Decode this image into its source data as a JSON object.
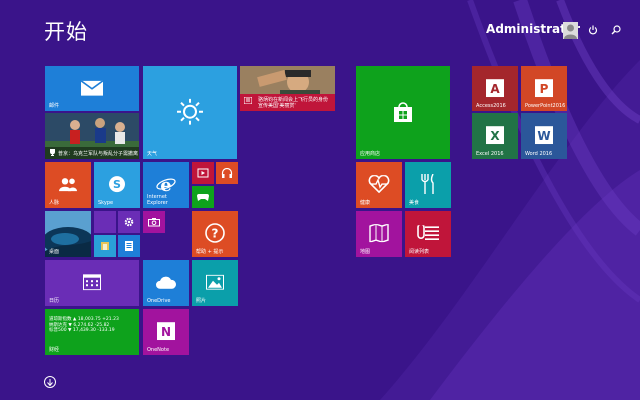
{
  "header": {
    "title": "开始",
    "user_name": "Administrator"
  },
  "icons": {
    "power": "power-icon",
    "search": "search-icon",
    "down": "arrow-down-icon"
  },
  "colors": {
    "background": "#3a148a",
    "blue": "#1e7fd8",
    "red": "#dd4c24",
    "green": "#0ea21c",
    "purple": "#6a2db6",
    "magenta": "#a2139e",
    "lightblue": "#2ca0e0",
    "teal": "#0b9faa",
    "access": "#a4262c",
    "powerpoint": "#d24726",
    "excel": "#217346",
    "word": "#2b579a"
  },
  "tiles": {
    "mail": "邮件",
    "news_caption": "普京：乌克兰军队与叛乱分子需撤离",
    "weather": "天气",
    "news_headline": "骆炳钧在新闻会上飞行员的身份宣传美国'美丽赏'",
    "store": "应用商店",
    "access": "Access2016",
    "powerpoint": "PowerPoint2016",
    "excel": "Excel 2016",
    "word": "Word 2016",
    "people": "人脉",
    "skype": "Skype",
    "ie": "Internet Explorer",
    "help": "帮助 + 提示",
    "health": "健康",
    "food": "美食",
    "desktop": "桌面",
    "maps": "地图",
    "reading": "阅读列表",
    "calendar": "日历",
    "onedrive": "OneDrive",
    "photos": "照片",
    "finance": "财经",
    "onenote": "OneNote",
    "stocks": [
      "道琼斯指数 ▲ 18,003.75 +21.23",
      "纳斯达克 ▼ 6,274.62 -25.82",
      "标普500 ▼ 17,439.30 -133.19"
    ]
  }
}
